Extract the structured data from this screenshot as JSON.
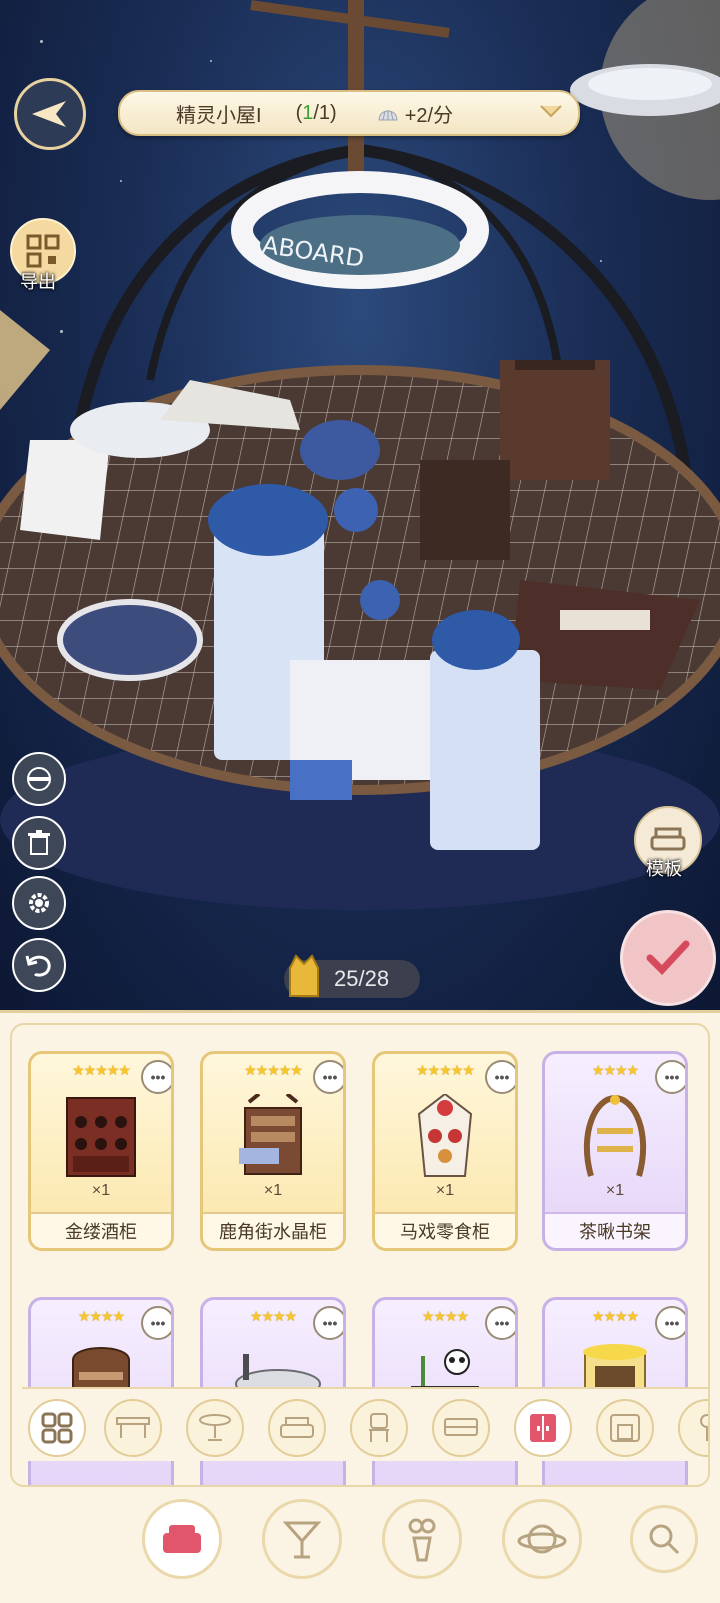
{
  "header": {
    "room_name": "精灵小屋I",
    "count_open": "(",
    "count_current": "1",
    "count_rest": "/1)",
    "income": "+2/分"
  },
  "export_label": "导出",
  "template_label": "模板",
  "capacity": "25/28",
  "cards": [
    {
      "name": "金缕酒柜",
      "qty": "×1",
      "stars": "★★★★★",
      "tier": "gold",
      "icon": "wine-cabinet-icon"
    },
    {
      "name": "鹿角街水晶柜",
      "qty": "×1",
      "stars": "★★★★★",
      "tier": "gold",
      "icon": "crystal-cabinet-icon"
    },
    {
      "name": "马戏零食柜",
      "qty": "×1",
      "stars": "★★★★★",
      "tier": "gold",
      "icon": "snack-cabinet-icon"
    },
    {
      "name": "茶啾书架",
      "qty": "×1",
      "stars": "★★★★",
      "tier": "purple",
      "icon": "bookshelf-icon"
    },
    {
      "stars": "★★★★",
      "tier": "purple",
      "icon": "shelf-icon"
    },
    {
      "stars": "★★★★",
      "tier": "purple",
      "icon": "bathtub-icon"
    },
    {
      "stars": "★★★★",
      "tier": "purple",
      "icon": "panda-stand-icon"
    },
    {
      "stars": "★★★★",
      "tier": "purple",
      "icon": "lemon-cabinet-icon"
    }
  ],
  "more_symbol": "•••",
  "categories": [
    "all-icon",
    "table-icon",
    "round-table-icon",
    "sofa-icon",
    "chair-icon",
    "bed-icon",
    "cabinet-icon",
    "fireplace-icon",
    "lamp-icon"
  ],
  "active_category": "cabinet-icon",
  "nav": [
    "furniture-icon",
    "drink-icon",
    "vase-icon",
    "planet-icon",
    "search-icon"
  ],
  "colors": {
    "gold": "#e6c77a",
    "purple": "#c8b1e6",
    "active": "#e2566b",
    "green": "#3f9f36"
  }
}
